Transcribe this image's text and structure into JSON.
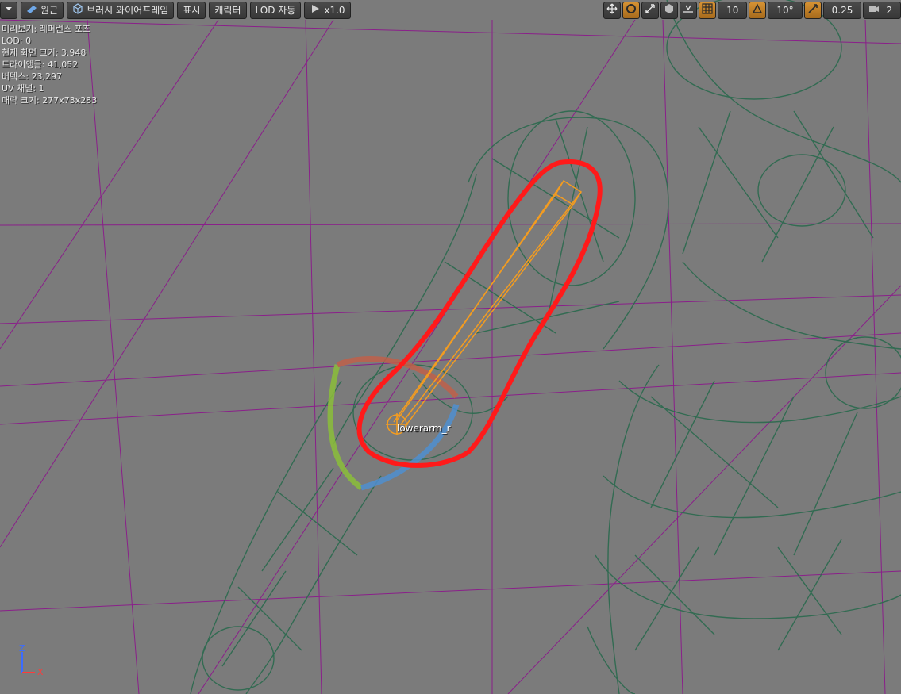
{
  "toolbar": {
    "menu_icon": "chevron-down-icon",
    "perspective_label": "원근",
    "viewmode_label": "브러시 와이어프레임",
    "show_label": "표시",
    "character_label": "캐릭터",
    "lod_label": "LOD 자동",
    "playspeed_label": "x1.0",
    "grid_snap_value": "10",
    "rotation_snap_value": "10°",
    "scale_snap_value": "0.25",
    "camera_speed_value": "2"
  },
  "stats": {
    "preview": "미리보기: 레퍼런스 포즈",
    "lod": "LOD: 0",
    "screen_size": "현재 화면 크기: 3.948",
    "triangles": "트라이앵글: 41,052",
    "vertices": "버텍스: 23,297",
    "uv_channels": "UV 채널: 1",
    "approx_size": "대략 크기: 277x73x283"
  },
  "bone": {
    "name": "lowerarm_r"
  },
  "axis": {
    "z": "Z",
    "x": "X"
  },
  "colors": {
    "background": "#7b7b7b",
    "wireframe": "#2f6b50",
    "grid": "#8a1f8a",
    "bone": "#f39c20",
    "highlight": "#ff1a1a",
    "active_button": "#d08a2a"
  }
}
